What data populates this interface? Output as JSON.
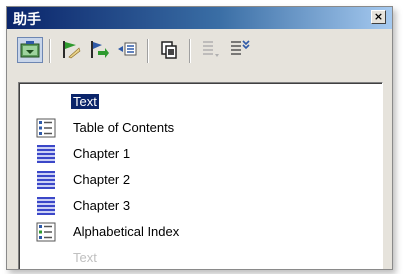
{
  "window": {
    "title": "助手",
    "close_glyph": "×"
  },
  "toolbar": {
    "buttons": [
      {
        "name": "toggle-button",
        "icon": "content-view-icon",
        "active": true
      },
      {
        "name": "navigate-chapter-up-button",
        "icon": "promote-icon"
      },
      {
        "name": "drag-mode-button",
        "icon": "drag-mode-icon"
      },
      {
        "name": "demote-button",
        "icon": "demote-icon"
      },
      {
        "name": "copy-button",
        "icon": "copy-icon"
      },
      {
        "name": "heading-levels-button",
        "icon": "heading-levels-icon"
      },
      {
        "name": "list-box-button",
        "icon": "list-box-icon"
      }
    ]
  },
  "list": {
    "items": [
      {
        "label": "Text",
        "selected": true,
        "icon": "none"
      },
      {
        "label": "Table of Contents",
        "icon": "toc-icon"
      },
      {
        "label": "Chapter 1",
        "icon": "chapter-icon"
      },
      {
        "label": "Chapter 2",
        "icon": "chapter-icon"
      },
      {
        "label": "Chapter 3",
        "icon": "chapter-icon"
      },
      {
        "label": "Alphabetical Index",
        "icon": "index-icon"
      },
      {
        "label": "Text",
        "dim": true,
        "icon": "none"
      }
    ]
  },
  "colors": {
    "selection": "#0a246a",
    "title_gradient_start": "#0a246a",
    "title_gradient_end": "#a6caf0"
  }
}
